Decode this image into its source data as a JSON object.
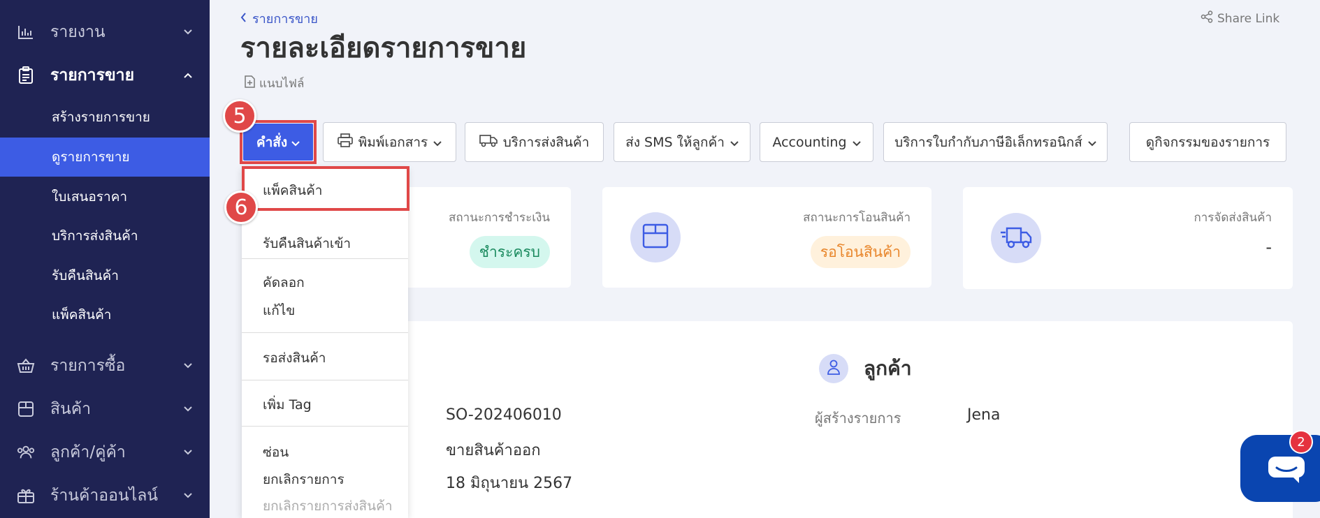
{
  "sidebar": {
    "report": "รายงาน",
    "sales": "รายการขาย",
    "sales_sub": {
      "create": "สร้างรายการขาย",
      "view": "ดูรายการขาย",
      "quotation": "ใบเสนอราคา",
      "shipping": "บริการส่งสินค้า",
      "returns": "รับคืนสินค้า",
      "pack": "แพ็คสินค้า"
    },
    "purchases": "รายการซื้อ",
    "products": "สินค้า",
    "contacts": "ลูกค้า/คู่ค้า",
    "online_store": "ร้านค้าออนไลน์"
  },
  "header": {
    "breadcrumb": "รายการขาย",
    "title": "รายละเอียดรายการขาย",
    "share": "Share Link",
    "attach": "แนบไฟล์"
  },
  "toolbar": {
    "command": "คำสั่ง",
    "print": "พิมพ์เอกสาร",
    "shipping": "บริการส่งสินค้า",
    "sms": "ส่ง SMS ให้ลูกค้า",
    "accounting": "Accounting",
    "etax": "บริการใบกำกับภาษีอิเล็กทรอนิกส์",
    "activity": "ดูกิจกรรมของรายการ"
  },
  "steps": {
    "five": "5",
    "six": "6"
  },
  "dropdown": {
    "pack": "แพ็คสินค้า",
    "return_in": "รับคืนสินค้าเข้า",
    "copy": "คัดลอก",
    "edit": "แก้ไข",
    "await_ship": "รอส่งสินค้า",
    "add_tag": "เพิ่ม Tag",
    "hide": "ซ่อน",
    "cancel": "ยกเลิกรายการ",
    "cancel_ship": "ยกเลิกรายการส่งสินค้า"
  },
  "status": {
    "payment_label": "สถานะการชำระเงิน",
    "payment_value": "ชำระครบ",
    "transfer_label": "สถานะการโอนสินค้า",
    "transfer_value": "รอโอนสินค้า",
    "delivery_label": "การจัดส่งสินค้า",
    "delivery_value": "-"
  },
  "detail": {
    "customer_heading": "ลูกค้า",
    "doc_no": "SO-202406010",
    "type": "ขายสินค้าออก",
    "date": "18 มิถุนายน 2567",
    "creator_label": "ผู้สร้างรายการ",
    "creator_value": "Jena"
  },
  "chat": {
    "badge": "2"
  },
  "colors": {
    "sidebar": "#1f2353",
    "accent": "#3d5ce4",
    "highlight": "#e04848",
    "paid_bg": "#d4f7ee",
    "paid_text": "#1a8a5e",
    "pending_bg": "#fff1dc",
    "pending_text": "#e8852a"
  }
}
